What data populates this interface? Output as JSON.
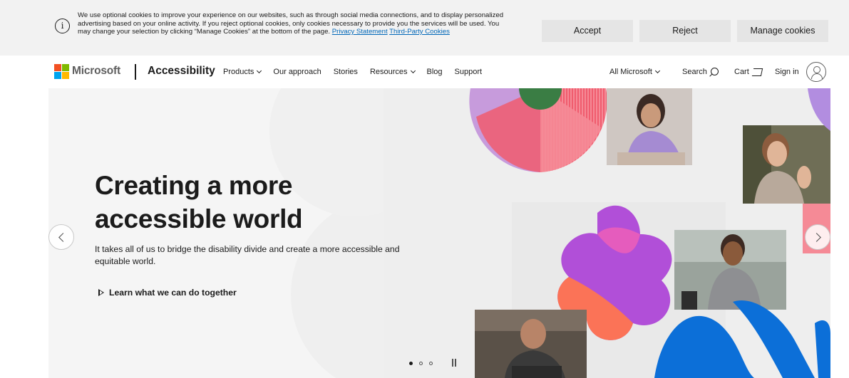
{
  "cookie_banner": {
    "text": "We use optional cookies to improve your experience on our websites, such as through social media connections, and to display personalized advertising based on your online activity. If you reject optional cookies, only cookies necessary to provide you the services will be used. You may change your selection by clicking “Manage Cookies” at the bottom of the page.",
    "privacy_link": "Privacy Statement",
    "third_party_link": "Third-Party Cookies",
    "accept_label": "Accept",
    "reject_label": "Reject",
    "manage_label": "Manage cookies",
    "info_icon": "info-icon"
  },
  "header": {
    "brand": "Microsoft",
    "site_title": "Accessibility",
    "nav": [
      {
        "label": "Products",
        "dropdown": true
      },
      {
        "label": "Our approach",
        "dropdown": false
      },
      {
        "label": "Stories",
        "dropdown": false
      },
      {
        "label": "Resources",
        "dropdown": true
      },
      {
        "label": "Blog",
        "dropdown": false
      },
      {
        "label": "Support",
        "dropdown": false
      }
    ],
    "all_microsoft": "All Microsoft",
    "search_label": "Search",
    "cart_label": "Cart",
    "sign_in_label": "Sign in",
    "logo_colors": [
      "#f25022",
      "#7fba00",
      "#00a4ef",
      "#ffb900"
    ]
  },
  "hero": {
    "title": "Creating a more accessible world",
    "subtitle": "It takes all of us to bridge the disability divide and create a more accessible and equitable world.",
    "cta_label": "Learn what we can do together",
    "slide_count": 3,
    "active_slide": 1
  },
  "colors": {
    "accent_link": "#0067b8",
    "banner_bg": "#f2f2f2",
    "button_bg": "#e5e5e5",
    "hero_bg": "#f5f5f5",
    "pink": "#f05c6e",
    "purple": "#b14fd8",
    "lavender": "#c79bdc",
    "green": "#3a7d44",
    "coral": "#fb7357",
    "blue": "#0c6fd8"
  }
}
